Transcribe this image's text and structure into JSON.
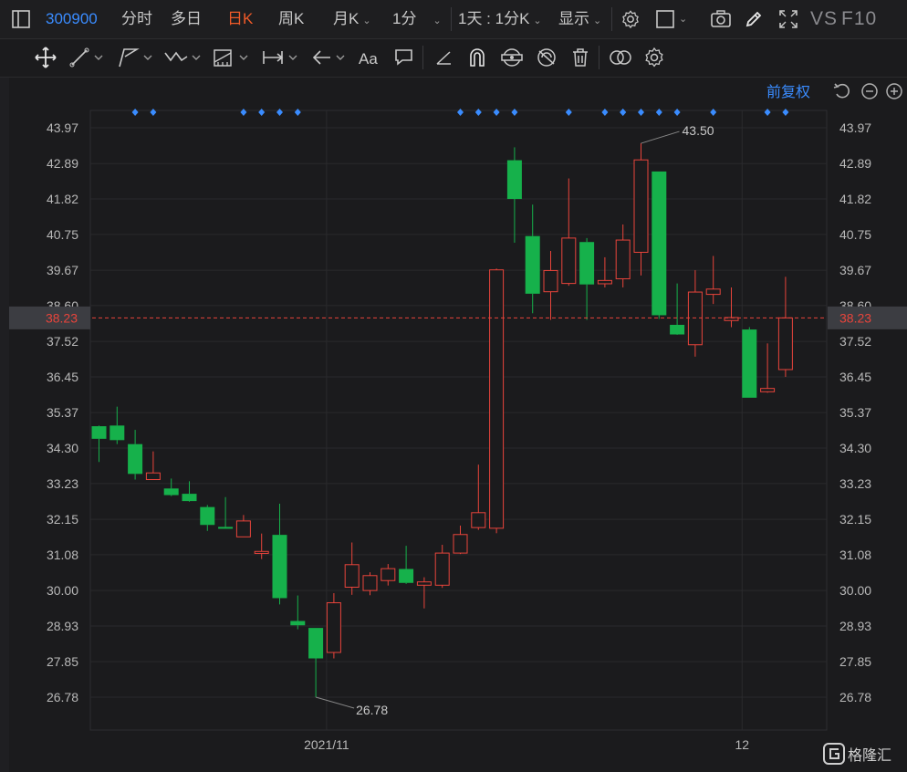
{
  "header": {
    "code": "300900",
    "tabs": [
      {
        "label": "分时",
        "active": false
      },
      {
        "label": "多日",
        "active": false
      },
      {
        "label": "日K",
        "active": true
      },
      {
        "label": "周K",
        "active": false
      },
      {
        "label": "月K",
        "active": false
      },
      {
        "label": "1分",
        "active": false
      }
    ],
    "period_select": "1天 : 1分K",
    "display_label": "显示",
    "vs_label": "VS",
    "f10_label": "F10"
  },
  "chart": {
    "adjust_label": "前复权",
    "price_marker": "38.23",
    "max_label": "43.50",
    "min_label": "26.78",
    "colors": {
      "up": "#e8443b",
      "down": "#16b14b",
      "accent": "#f05a28",
      "link": "#3a8cff"
    },
    "watermark_text": "格隆汇"
  },
  "chart_data": {
    "type": "candlestick",
    "y_ticks": [
      "43.97",
      "42.89",
      "41.82",
      "40.75",
      "39.67",
      "38.60",
      "37.52",
      "36.45",
      "35.37",
      "34.30",
      "33.23",
      "32.15",
      "31.08",
      "30.00",
      "28.93",
      "27.85",
      "26.78"
    ],
    "ylim": [
      25.8,
      44.9
    ],
    "x_labels": [
      {
        "label": "2021/11",
        "index": 13
      },
      {
        "label": "12",
        "index": 36
      }
    ],
    "current_price": 38.23,
    "candles": [
      {
        "o": 34.96,
        "h": 34.98,
        "l": 33.88,
        "c": 34.58
      },
      {
        "o": 34.98,
        "h": 35.55,
        "l": 34.42,
        "c": 34.54
      },
      {
        "o": 34.42,
        "h": 34.85,
        "l": 33.35,
        "c": 33.52
      },
      {
        "o": 33.35,
        "h": 34.2,
        "l": 33.35,
        "c": 33.55
      },
      {
        "o": 33.08,
        "h": 33.38,
        "l": 32.85,
        "c": 32.88
      },
      {
        "o": 32.92,
        "h": 33.3,
        "l": 32.68,
        "c": 32.7
      },
      {
        "o": 32.52,
        "h": 32.58,
        "l": 31.8,
        "c": 31.98
      },
      {
        "o": 31.92,
        "h": 32.82,
        "l": 31.9,
        "c": 31.91
      },
      {
        "o": 31.62,
        "h": 32.28,
        "l": 31.62,
        "c": 32.1
      },
      {
        "o": 31.12,
        "h": 31.72,
        "l": 30.95,
        "c": 31.18
      },
      {
        "o": 31.68,
        "h": 32.62,
        "l": 29.58,
        "c": 29.77
      },
      {
        "o": 29.08,
        "h": 29.85,
        "l": 28.83,
        "c": 28.95
      },
      {
        "o": 28.87,
        "h": 28.87,
        "l": 26.78,
        "c": 27.95
      },
      {
        "o": 28.13,
        "h": 29.92,
        "l": 27.95,
        "c": 29.63
      },
      {
        "o": 30.1,
        "h": 31.45,
        "l": 29.87,
        "c": 30.78
      },
      {
        "o": 30.0,
        "h": 30.55,
        "l": 29.86,
        "c": 30.45
      },
      {
        "o": 30.3,
        "h": 30.8,
        "l": 30.15,
        "c": 30.66
      },
      {
        "o": 30.65,
        "h": 31.35,
        "l": 30.2,
        "c": 30.23
      },
      {
        "o": 30.16,
        "h": 30.4,
        "l": 29.46,
        "c": 30.26
      },
      {
        "o": 30.16,
        "h": 31.38,
        "l": 30.08,
        "c": 31.13
      },
      {
        "o": 31.13,
        "h": 31.96,
        "l": 31.1,
        "c": 31.69
      },
      {
        "o": 31.9,
        "h": 33.8,
        "l": 31.83,
        "c": 32.35
      },
      {
        "o": 31.88,
        "h": 39.72,
        "l": 31.73,
        "c": 39.68
      },
      {
        "o": 42.99,
        "h": 43.38,
        "l": 40.5,
        "c": 41.82
      },
      {
        "o": 40.7,
        "h": 41.65,
        "l": 38.37,
        "c": 38.96
      },
      {
        "o": 39.02,
        "h": 40.25,
        "l": 38.17,
        "c": 39.66
      },
      {
        "o": 39.27,
        "h": 42.44,
        "l": 39.2,
        "c": 40.64
      },
      {
        "o": 40.52,
        "h": 40.64,
        "l": 38.17,
        "c": 39.24
      },
      {
        "o": 39.26,
        "h": 40.06,
        "l": 39.15,
        "c": 39.36
      },
      {
        "o": 39.41,
        "h": 41.05,
        "l": 39.15,
        "c": 40.58
      },
      {
        "o": 40.21,
        "h": 43.5,
        "l": 39.51,
        "c": 43.0
      },
      {
        "o": 42.65,
        "h": 42.65,
        "l": 38.2,
        "c": 38.31
      },
      {
        "o": 38.02,
        "h": 39.27,
        "l": 37.72,
        "c": 37.73
      },
      {
        "o": 37.42,
        "h": 39.67,
        "l": 37.06,
        "c": 39.01
      },
      {
        "o": 38.94,
        "h": 40.1,
        "l": 38.65,
        "c": 39.1
      },
      {
        "o": 38.15,
        "h": 39.15,
        "l": 37.95,
        "c": 38.24
      },
      {
        "o": 37.88,
        "h": 37.95,
        "l": 35.82,
        "c": 35.82
      },
      {
        "o": 36.0,
        "h": 37.46,
        "l": 35.97,
        "c": 36.1
      },
      {
        "o": 36.67,
        "h": 39.47,
        "l": 36.45,
        "c": 38.23
      }
    ],
    "event_marker_indices": [
      2,
      3,
      8,
      9,
      10,
      11,
      20,
      21,
      22,
      23,
      26,
      28,
      29,
      29,
      30,
      31,
      32,
      34,
      37,
      38
    ]
  }
}
